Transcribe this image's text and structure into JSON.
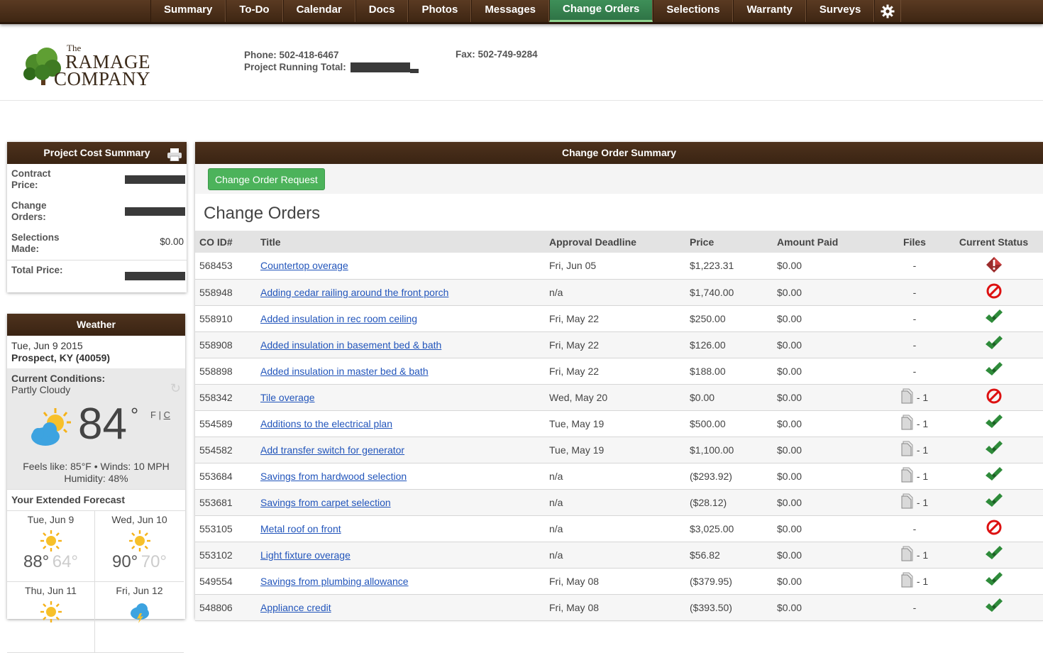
{
  "nav": {
    "items": [
      {
        "label": "Summary",
        "active": false
      },
      {
        "label": "To-Do",
        "active": false
      },
      {
        "label": "Calendar",
        "active": false
      },
      {
        "label": "Docs",
        "active": false
      },
      {
        "label": "Photos",
        "active": false
      },
      {
        "label": "Messages",
        "active": false
      },
      {
        "label": "Change Orders",
        "active": true
      },
      {
        "label": "Selections",
        "active": false
      },
      {
        "label": "Warranty",
        "active": false
      },
      {
        "label": "Surveys",
        "active": false
      }
    ],
    "settings_icon": "gear-icon"
  },
  "header": {
    "logo_the": "The",
    "logo_line1": "RAMAGE",
    "logo_line2": "COMPANY",
    "phone": "Phone: 502-418-6467",
    "running_total_label": "Project Running Total:",
    "fax": "Fax: 502-749-9284"
  },
  "cost_summary": {
    "title": "Project Cost Summary",
    "rows": [
      {
        "label": "Contract Price:",
        "value": null
      },
      {
        "label": "Change Orders:",
        "value": null
      },
      {
        "label": "Selections Made:",
        "value": "$0.00"
      },
      {
        "label": "Total Price:",
        "value": null
      }
    ]
  },
  "weather": {
    "title": "Weather",
    "date": "Tue, Jun 9 2015",
    "location": "Prospect, KY (40059)",
    "conditions_label": "Current Conditions:",
    "conditions": "Partly Cloudy",
    "temp": "84",
    "deg": "°",
    "unit_f": "F",
    "unit_sep": "|",
    "unit_c": "C",
    "feels": "Feels like: 85°F • Winds: 10 MPH",
    "humidity": "Humidity: 48%",
    "extended_label": "Your Extended Forecast",
    "forecast": [
      {
        "day": "Tue, Jun 9",
        "hi": "88°",
        "lo": "64°",
        "icon": "sun-icon"
      },
      {
        "day": "Wed, Jun 10",
        "hi": "90°",
        "lo": "70°",
        "icon": "sun-icon"
      },
      {
        "day": "Thu, Jun 11",
        "hi": "",
        "lo": "",
        "icon": "sun-icon"
      },
      {
        "day": "Fri, Jun 12",
        "hi": "",
        "lo": "",
        "icon": "storm-icon"
      }
    ]
  },
  "change_orders": {
    "panel_title": "Change Order Summary",
    "request_button": "Change Order Request",
    "heading": "Change Orders",
    "columns": [
      "CO ID#",
      "Title",
      "Approval Deadline",
      "Price",
      "Amount Paid",
      "Files",
      "Current Status"
    ],
    "rows": [
      {
        "id": "568453",
        "title": "Countertop overage",
        "deadline": "Fri, Jun 05",
        "price": "$1,223.31",
        "paid": "$0.00",
        "files": "-",
        "status": "pending"
      },
      {
        "id": "558948",
        "title": "Adding cedar railing around the front porch",
        "deadline": "n/a",
        "price": "$1,740.00",
        "paid": "$0.00",
        "files": "-",
        "status": "declined"
      },
      {
        "id": "558910",
        "title": "Added insulation in rec room ceiling",
        "deadline": "Fri, May 22",
        "price": "$250.00",
        "paid": "$0.00",
        "files": "-",
        "status": "approved"
      },
      {
        "id": "558908",
        "title": "Added insulation in basement bed & bath",
        "deadline": "Fri, May 22",
        "price": "$126.00",
        "paid": "$0.00",
        "files": "-",
        "status": "approved"
      },
      {
        "id": "558898",
        "title": "Added insulation in master bed & bath",
        "deadline": "Fri, May 22",
        "price": "$188.00",
        "paid": "$0.00",
        "files": "-",
        "status": "approved"
      },
      {
        "id": "558342",
        "title": "Tile overage",
        "deadline": "Wed, May 20",
        "price": "$0.00",
        "paid": "$0.00",
        "files": "- 1",
        "status": "declined"
      },
      {
        "id": "554589",
        "title": "Additions to the electrical plan",
        "deadline": "Tue, May 19",
        "price": "$500.00",
        "paid": "$0.00",
        "files": "- 1",
        "status": "approved"
      },
      {
        "id": "554582",
        "title": "Add transfer switch for generator",
        "deadline": "Tue, May 19",
        "price": "$1,100.00",
        "paid": "$0.00",
        "files": "- 1",
        "status": "approved"
      },
      {
        "id": "553684",
        "title": "Savings from hardwood selection",
        "deadline": "n/a",
        "price": "($293.92)",
        "paid": "$0.00",
        "files": "- 1",
        "status": "approved"
      },
      {
        "id": "553681",
        "title": "Savings from carpet selection",
        "deadline": "n/a",
        "price": "($28.12)",
        "paid": "$0.00",
        "files": "- 1",
        "status": "approved"
      },
      {
        "id": "553105",
        "title": "Metal roof on front",
        "deadline": "n/a",
        "price": "$3,025.00",
        "paid": "$0.00",
        "files": "-",
        "status": "declined"
      },
      {
        "id": "553102",
        "title": "Light fixture overage",
        "deadline": "n/a",
        "price": "$56.82",
        "paid": "$0.00",
        "files": "- 1",
        "status": "approved"
      },
      {
        "id": "549554",
        "title": "Savings from plumbing allowance",
        "deadline": "Fri, May 08",
        "price": "($379.95)",
        "paid": "$0.00",
        "files": "- 1",
        "status": "approved"
      },
      {
        "id": "548806",
        "title": "Appliance credit",
        "deadline": "Fri, May 08",
        "price": "($393.50)",
        "paid": "$0.00",
        "files": "-",
        "status": "approved"
      }
    ]
  },
  "colors": {
    "nav_brown": "#4a2f1b",
    "active_green": "#3e8f58",
    "button_green": "#4cb35b",
    "link_blue": "#2255bb",
    "declined_red": "#dd1111",
    "approved_green": "#2e8b3a"
  }
}
